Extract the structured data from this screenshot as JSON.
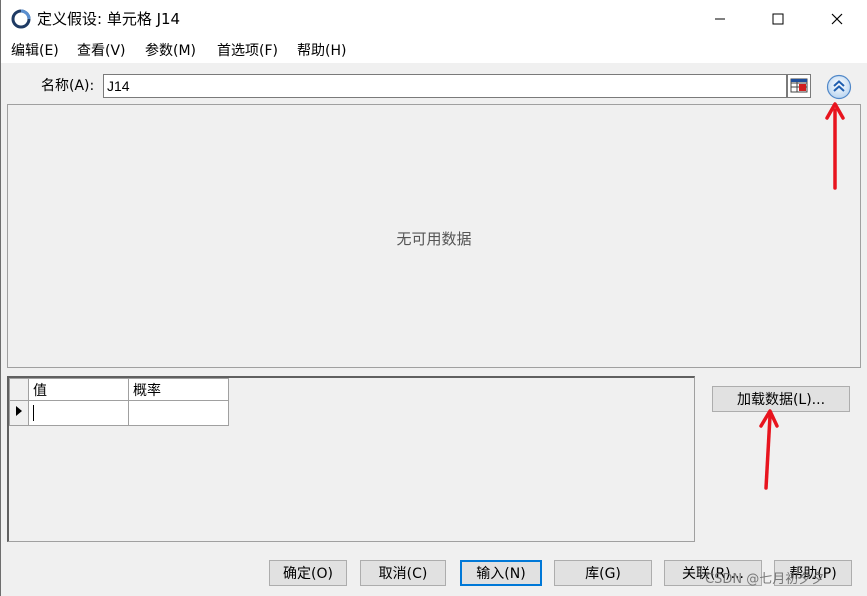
{
  "window": {
    "title": "定义假设: 单元格 J14"
  },
  "menu": {
    "items": [
      "编辑(E)",
      "查看(V)",
      "参数(M)",
      "首选项(F)",
      "帮助(H)"
    ]
  },
  "name_row": {
    "label": "名称(A):",
    "value": "J14"
  },
  "chart": {
    "empty_message": "无可用数据"
  },
  "grid": {
    "headers": [
      "值",
      "概率"
    ]
  },
  "side": {
    "load_data_label": "加载数据(L)..."
  },
  "footer": {
    "buttons": [
      "确定(O)",
      "取消(C)",
      "输入(N)",
      "库(G)",
      "关联(R)...",
      "帮助(P)"
    ]
  },
  "watermark": "CSDN @七月初夕夕",
  "colors": {
    "accent": "#0078d7",
    "annotation": "#e8141e"
  }
}
